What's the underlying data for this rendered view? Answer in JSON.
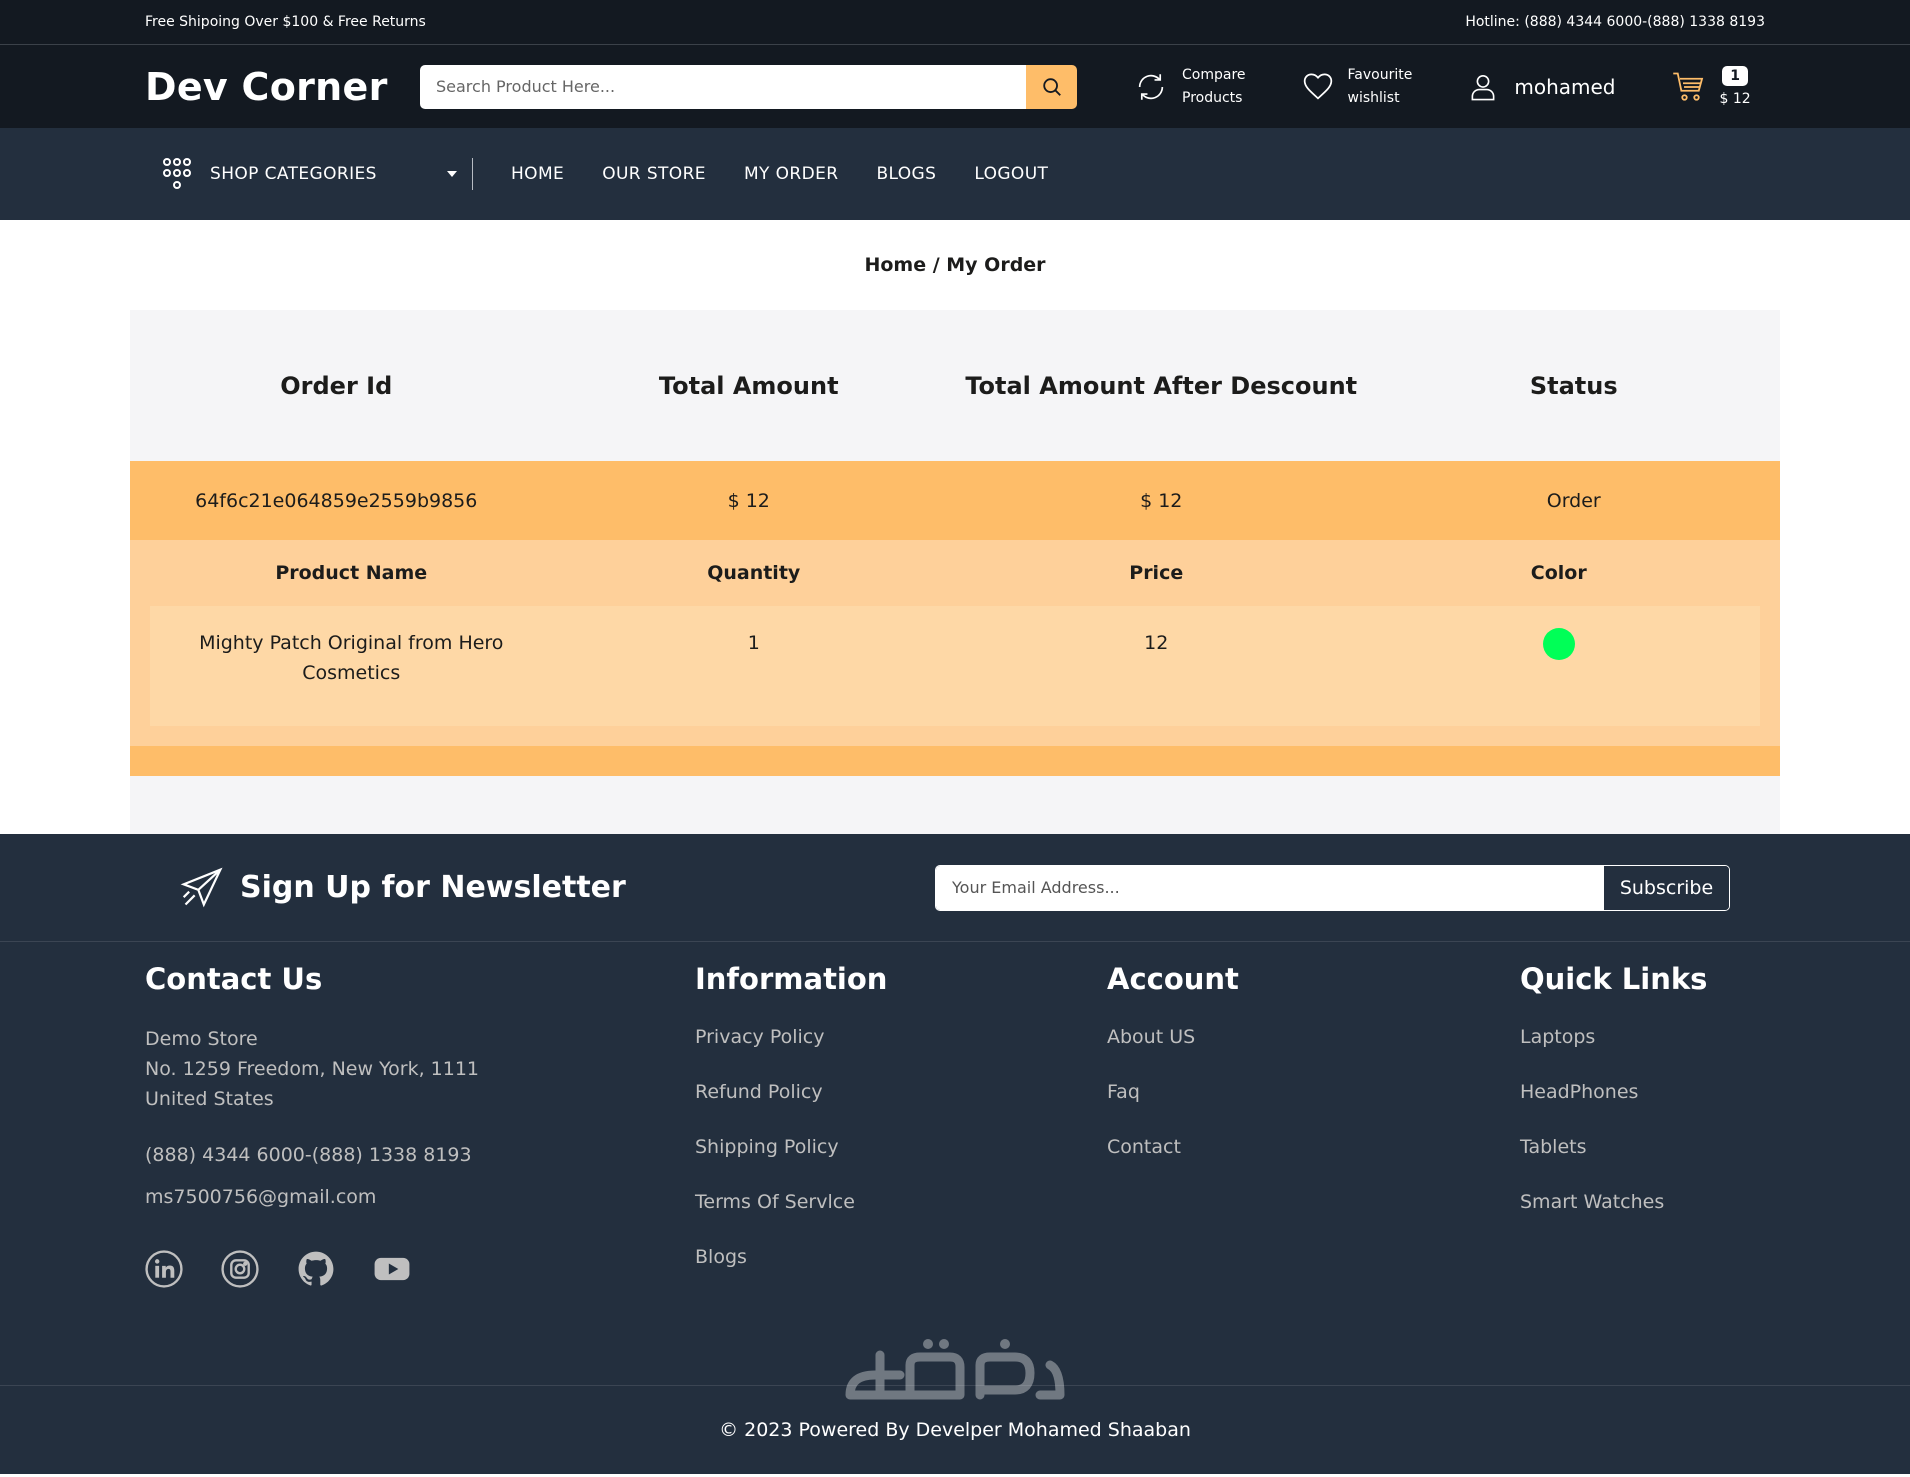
{
  "topbar": {
    "left": "Free Shipoing Over $100 & Free Returns",
    "right": "Hotline: (888) 4344 6000-(888) 1338 8193"
  },
  "header": {
    "logo": "Dev Corner",
    "search_placeholder": "Search Product Here...",
    "compare_line1": "Compare",
    "compare_line2": "Products",
    "wishlist_line1": "Favourite",
    "wishlist_line2": "wishlist",
    "username": "mohamed",
    "cart_count": "1",
    "cart_total": "$ 12"
  },
  "nav": {
    "categories": "SHOP CATEGORIES",
    "links": [
      "HOME",
      "OUR STORE",
      "MY ORDER",
      "BLOGS",
      "LOGOUT"
    ]
  },
  "breadcrumb": "Home / My Order",
  "orders": {
    "headers": [
      "Order Id",
      "Total Amount",
      "Total Amount After Descount",
      "Status"
    ],
    "order": {
      "id": "64f6c21e064859e2559b9856",
      "total": "$ 12",
      "total_after_discount": "$ 12",
      "status": "Order"
    },
    "item_headers": [
      "Product Name",
      "Quantity",
      "Price",
      "Color"
    ],
    "items": [
      {
        "name": "Mighty Patch Original from Hero Cosmetics",
        "quantity": "1",
        "price": "12",
        "color": "#00ff57"
      }
    ]
  },
  "newsletter": {
    "title": "Sign Up for Newsletter",
    "placeholder": "Your Email Address...",
    "button": "Subscribe"
  },
  "footer": {
    "contact": {
      "title": "Contact Us",
      "address_line1": "Demo Store",
      "address_line2": "No. 1259 Freedom, New York, 1111",
      "address_line3": "United States",
      "phone": "(888) 4344 6000-(888) 1338 8193",
      "email": "ms7500756@gmail.com"
    },
    "information": {
      "title": "Information",
      "links": [
        "Privacy Policy",
        "Refund Policy",
        "Shipping Policy",
        "Terms Of Servlce",
        "Blogs"
      ]
    },
    "account": {
      "title": "Account",
      "links": [
        "About US",
        "Faq",
        "Contact"
      ]
    },
    "quick_links": {
      "title": "Quick Links",
      "links": [
        "Laptops",
        "HeadPhones",
        "Tablets",
        "Smart Watches"
      ]
    },
    "social_icons": [
      "linkedin-icon",
      "instagram-icon",
      "github-icon",
      "youtube-icon"
    ]
  },
  "copyright": "© 2023 Powered By Develper Mohamed Shaaban",
  "colors": {
    "dark": "#131921",
    "navy": "#232f3e",
    "accent": "#febd69",
    "product_color": "#00ff57"
  }
}
